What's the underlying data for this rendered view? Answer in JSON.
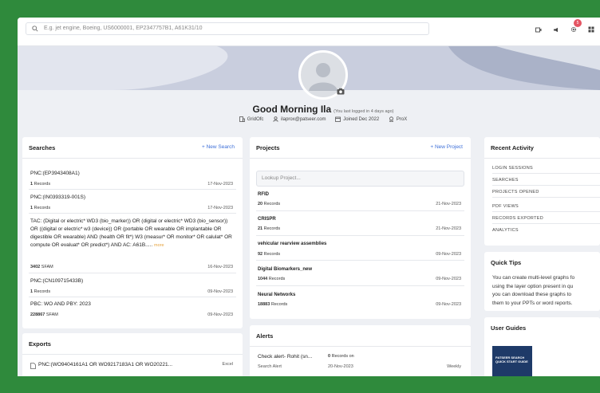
{
  "search": {
    "placeholder": "E.g. jet engine, Boeing, US6000001, EP2347757B1, A61K31/10"
  },
  "header": {
    "notification_count": "5",
    "icons": [
      "video-icon",
      "megaphone-icon",
      "gear-icon",
      "grid-icon"
    ]
  },
  "profile": {
    "greeting": "Good Morning Ila",
    "last_login": "(You last logged in 4 days ago)",
    "company": "GridOfc",
    "email": "ilaprox@patseer.com",
    "joined": "Joined Dec 2022",
    "plan": "ProX"
  },
  "colors": {
    "accent": "#3d6fd8",
    "badge": "#e45563",
    "background": "#2f8a3c"
  },
  "searches": {
    "title": "Searches",
    "new_label": "+ New Search",
    "items": [
      {
        "query": "PNC:(EP3943408A1)",
        "count": "1",
        "unit": "Records",
        "date": "17-Nov-2023"
      },
      {
        "query": "PNC:(IN0393319-001S)",
        "count": "1",
        "unit": "Records",
        "date": "17-Nov-2023"
      },
      {
        "query": "TAC: (Digital or electric* WD3 (bio_marker)) OR (digital or electric* WD3 (bio_sensor)) OR ((digital or electric* w3 (device)) OR (portable OR wearable OR implantable OR digestible OR wearable) AND (health OR fit*) W3 (measur* OR monitor* OR calulat* OR compute OR evaluat* OR predict*) AND AC: A61B.....",
        "more": "more",
        "count": "3402",
        "unit": "SFAM",
        "date": "16-Nov-2023"
      },
      {
        "query": "PNC:(CN109715433B)",
        "count": "1",
        "unit": "Records",
        "date": "09-Nov-2023"
      },
      {
        "query": "PBC: WO AND PBY: 2023",
        "count": "228867",
        "unit": "SFAM",
        "date": "09-Nov-2023"
      }
    ]
  },
  "exports": {
    "title": "Exports",
    "items": [
      {
        "name": "PNC:(WO9404161A1 OR WO9217183A1 OR WO20221...",
        "type": "Excel"
      }
    ]
  },
  "projects": {
    "title": "Projects",
    "new_label": "+ New Project",
    "lookup_placeholder": "Lookup Project...",
    "items": [
      {
        "name": "RFID",
        "count": "20",
        "unit": "Records",
        "date": "21-Nov-2023"
      },
      {
        "name": "CRISPR",
        "count": "21",
        "unit": "Records",
        "date": "21-Nov-2023"
      },
      {
        "name": "vehicular rearview assemblies",
        "count": "92",
        "unit": "Records",
        "date": "09-Nov-2023"
      },
      {
        "name": "Digital Biomarkers_new",
        "count": "1044",
        "unit": "Records",
        "date": "09-Nov-2023"
      },
      {
        "name": "Neural Networks",
        "count": "18883",
        "unit": "Records",
        "date": "09-Nov-2023"
      }
    ]
  },
  "alerts": {
    "title": "Alerts",
    "items": [
      {
        "name": "Check alert- Rohit (sn...",
        "count": "0",
        "unit": "Records on",
        "date": "20-Nov-2023",
        "kind": "Search Alert",
        "frequency": "Weekly"
      }
    ]
  },
  "activity": {
    "title": "Recent Activity",
    "items": [
      "LOGIN SESSIONS",
      "SEARCHES",
      "PROJECTS OPENED",
      "PDF VIEWS",
      "RECORDS EXPORTED",
      "ANALYTICS"
    ]
  },
  "tips": {
    "title": "Quick Tips",
    "text": "You can create multi-level graphs fo using the layer option present in qu you can download these graphs to them to your PPTs or word reports."
  },
  "guides": {
    "title": "User Guides",
    "book_title": "PATSEER SEARCH QUICK START GUIDE"
  }
}
